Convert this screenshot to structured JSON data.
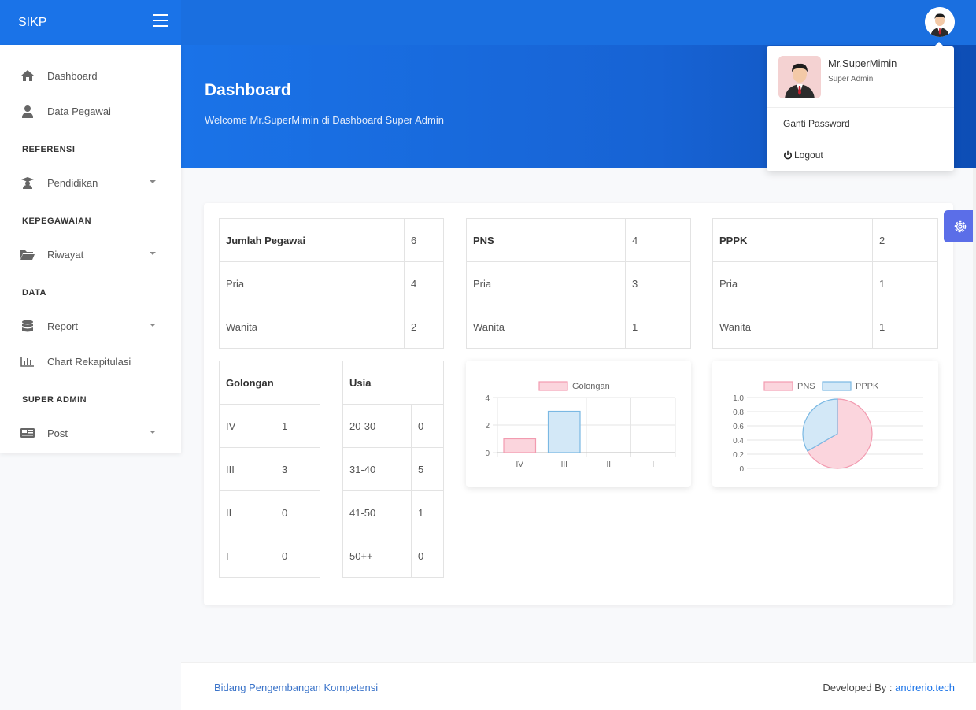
{
  "app": {
    "brand": "SIKP"
  },
  "hero": {
    "title": "Dashboard",
    "subtitle": "Welcome Mr.SuperMimin di Dashboard Super Admin"
  },
  "sidebar": {
    "items": [
      {
        "label": "Dashboard",
        "icon": "home-icon"
      },
      {
        "label": "Data Pegawai",
        "icon": "user-icon"
      },
      {
        "label": "Pendidikan",
        "icon": "graduation-icon"
      },
      {
        "label": "Riwayat",
        "icon": "folder-icon"
      },
      {
        "label": "Report",
        "icon": "database-icon"
      },
      {
        "label": "Chart Rekapitulasi",
        "icon": "bar-chart-icon"
      },
      {
        "label": "Post",
        "icon": "newspaper-icon"
      }
    ],
    "headings": [
      "REFERENSI",
      "KEPEGAWAIAN",
      "DATA",
      "SUPER ADMIN"
    ]
  },
  "user_menu": {
    "name": "Mr.SuperMimin",
    "role": "Super Admin",
    "change_password": "Ganti Password",
    "logout": "Logout"
  },
  "stats": {
    "total": {
      "rows": [
        [
          "Jumlah Pegawai",
          "6"
        ],
        [
          "Pria",
          "4"
        ],
        [
          "Wanita",
          "2"
        ]
      ]
    },
    "pns": {
      "rows": [
        [
          "PNS",
          "4"
        ],
        [
          "Pria",
          "3"
        ],
        [
          "Wanita",
          "1"
        ]
      ]
    },
    "pppk": {
      "rows": [
        [
          "PPPK",
          "2"
        ],
        [
          "Pria",
          "1"
        ],
        [
          "Wanita",
          "1"
        ]
      ]
    },
    "golongan": {
      "header": "Golongan",
      "rows": [
        [
          "IV",
          "1"
        ],
        [
          "III",
          "3"
        ],
        [
          "II",
          "0"
        ],
        [
          "I",
          "0"
        ]
      ]
    },
    "usia": {
      "header": "Usia",
      "rows": [
        [
          "20-30",
          "0"
        ],
        [
          "31-40",
          "5"
        ],
        [
          "41-50",
          "1"
        ],
        [
          "50++",
          "0"
        ]
      ]
    }
  },
  "chart_data": [
    {
      "type": "bar",
      "categories": [
        "IV",
        "III",
        "II",
        "I"
      ],
      "values": [
        1,
        3,
        0,
        0
      ],
      "legend": [
        "Golongan"
      ],
      "bar_colors": [
        "#fbd5dd",
        "#d3e8f7",
        "#fbd5dd",
        "#d3e8f7"
      ],
      "bar_borders": [
        "#f29bb0",
        "#7ab8e3",
        "#f29bb0",
        "#7ab8e3"
      ],
      "yticks": [
        "0",
        "2",
        "4"
      ],
      "ylim": [
        0,
        4
      ],
      "legend_position": "top"
    },
    {
      "type": "pie",
      "labels": [
        "PNS",
        "PPPK"
      ],
      "values": [
        4,
        2
      ],
      "colors": [
        "#fbd5dd",
        "#d3e8f7"
      ],
      "borders": [
        "#f29bb0",
        "#7ab8e3"
      ],
      "yticks": [
        "0",
        "0.2",
        "0.4",
        "0.6",
        "0.8",
        "1.0"
      ],
      "legend_position": "top"
    }
  ],
  "footer": {
    "left": "Bidang Pengembangan Kompetensi",
    "right_prefix": "Developed By :",
    "right_link": "andrerio.tech"
  },
  "colors": {
    "primary": "#1a73e8",
    "accent": "#5b6ee8"
  }
}
